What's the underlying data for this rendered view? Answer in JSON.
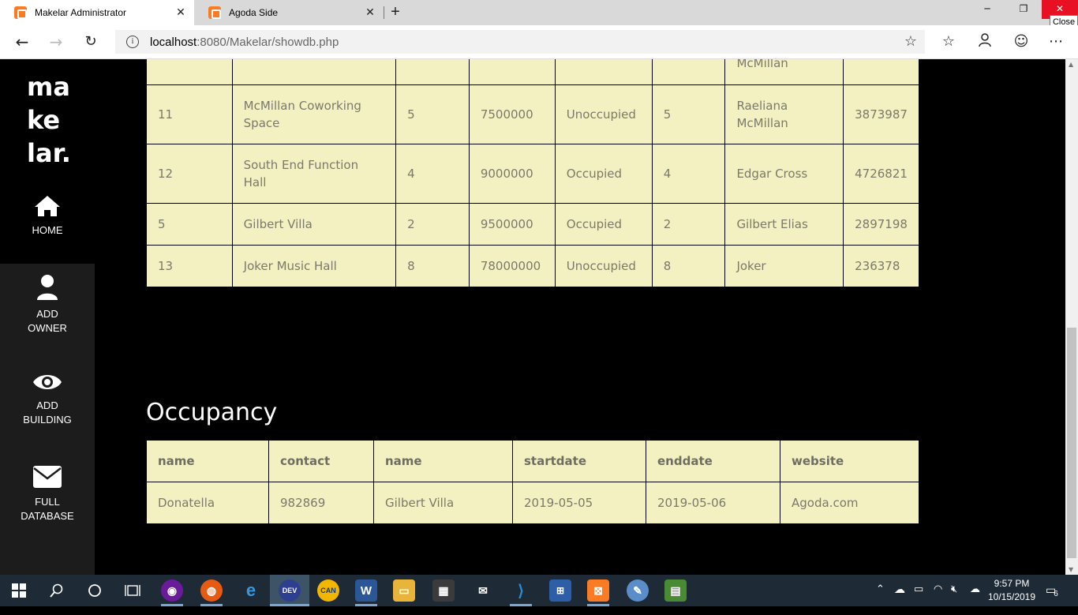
{
  "browser": {
    "tabs": [
      {
        "title": "Makelar Administrator",
        "active": true
      },
      {
        "title": "Agoda Side",
        "active": false
      }
    ],
    "url_host": "localhost",
    "url_rest": ":8080/Makelar/showdb.php",
    "tooltip": "Close"
  },
  "sidebar": {
    "logo_lines": [
      "ma",
      "ke",
      "lar."
    ],
    "items": [
      {
        "label": "HOME",
        "icon": "home-icon"
      },
      {
        "label": "ADD OWNER",
        "icon": "user-icon"
      },
      {
        "label": "ADD BUILDING",
        "icon": "eye-icon"
      },
      {
        "label": "FULL DATABASE",
        "icon": "envelope-icon"
      }
    ]
  },
  "buildings_table": {
    "partial_row": {
      "c6": "McMillan"
    },
    "rows": [
      [
        "11",
        "McMillan Coworking Space",
        "5",
        "7500000",
        "Unoccupied",
        "5",
        "Raeliana McMillan",
        "3873987"
      ],
      [
        "12",
        "South End Function Hall",
        "4",
        "9000000",
        "Occupied",
        "4",
        "Edgar Cross",
        "4726821"
      ],
      [
        "5",
        "Gilbert Villa",
        "2",
        "9500000",
        "Occupied",
        "2",
        "Gilbert Elias",
        "2897198"
      ],
      [
        "13",
        "Joker Music Hall",
        "8",
        "78000000",
        "Unoccupied",
        "8",
        "Joker",
        "236378"
      ]
    ]
  },
  "occupancy": {
    "title": "Occupancy",
    "headers": [
      "name",
      "contact",
      "name",
      "startdate",
      "enddate",
      "website"
    ],
    "rows": [
      [
        "Donatella",
        "982869",
        "Gilbert Villa",
        "2019-05-05",
        "2019-05-06",
        "Agoda.com"
      ]
    ]
  },
  "taskbar": {
    "clock_time": "9:57 PM",
    "clock_date": "10/15/2019",
    "notification_count": "6"
  }
}
